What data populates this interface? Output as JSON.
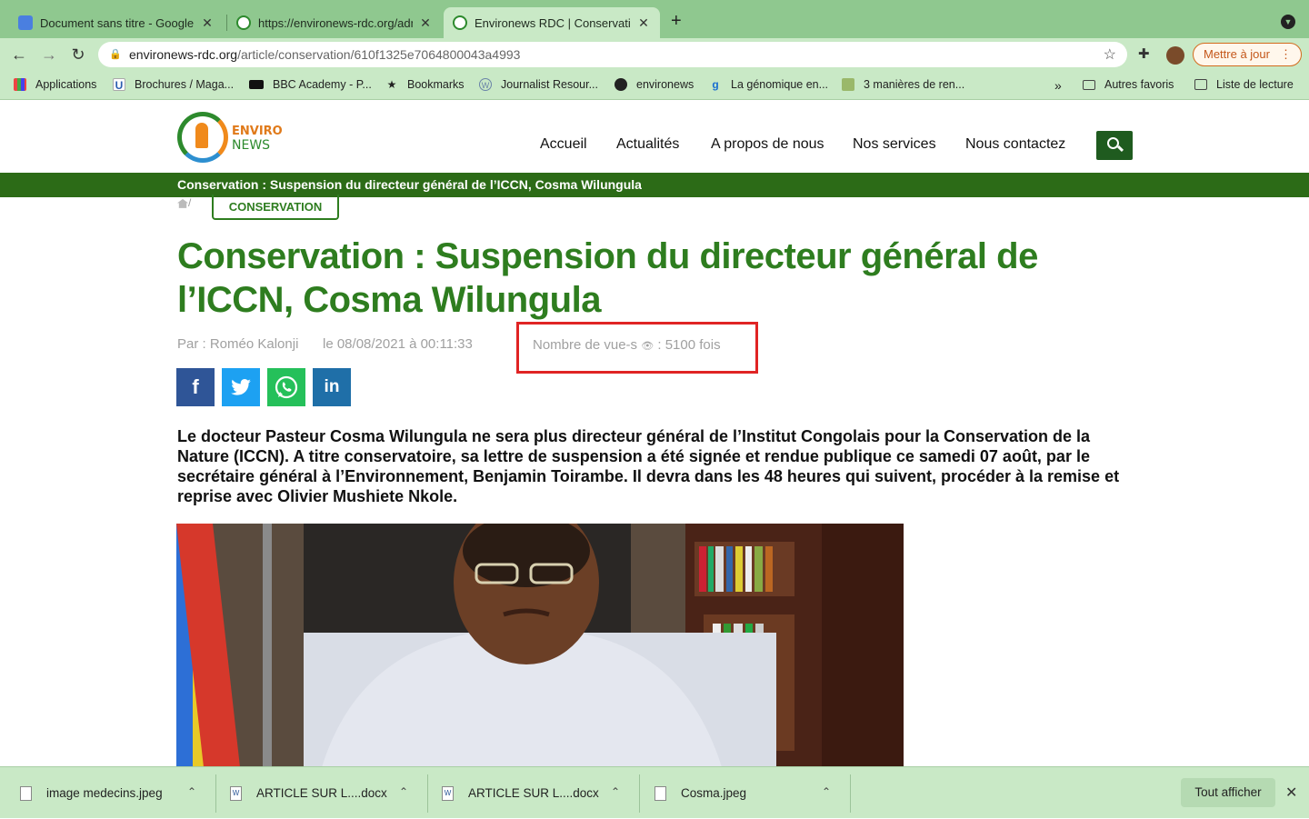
{
  "browser": {
    "tabs": [
      {
        "title": "Document sans titre - Google Docs",
        "active": false
      },
      {
        "title": "https://environews-rdc.org/admin",
        "active": false
      },
      {
        "title": "Environews RDC | Conservation",
        "active": true
      }
    ],
    "url_domain": "environews-rdc.org",
    "url_path": "/article/conservation/610f1325e7064800043a4993",
    "update_label": "Mettre à jour",
    "bookmarks": [
      "Applications",
      "Brochures / Maga...",
      "BBC Academy - P...",
      "Bookmarks",
      "Journalist Resour...",
      "environews",
      "La génomique en...",
      "3 manières de ren..."
    ],
    "bookmarks_right": [
      "Autres favoris",
      "Liste de lecture"
    ],
    "bookmark_overflow": "»"
  },
  "site": {
    "logo_line1": "ENVIRO",
    "logo_line2": "NEWS",
    "menu": [
      "Accueil",
      "Actualités",
      "A propos de nous",
      "Nos services",
      "Nous contactez"
    ],
    "ticker": "Conservation : Suspension du directeur général de l’ICCN, Cosma Wilungula"
  },
  "article": {
    "breadcrumb_sep": "/",
    "category": "CONSERVATION",
    "title": "Conservation : Suspension du directeur général de l’ICCN, Cosma Wilungula",
    "author": "Par : Roméo Kalonji",
    "date": "le 08/08/2021 à 00:11:33",
    "views_label": "Nombre de vue-s",
    "views_value": ": 5100 fois",
    "share": [
      {
        "name": "facebook",
        "glyph": "f",
        "color": "#2f5597"
      },
      {
        "name": "twitter",
        "glyph": "t",
        "color": "#1da1f2"
      },
      {
        "name": "whatsapp",
        "glyph": "w",
        "color": "#25c05a"
      },
      {
        "name": "linkedin",
        "glyph": "in",
        "color": "#1f6fa8"
      }
    ],
    "lead": "Le docteur Pasteur Cosma Wilungula ne sera plus directeur général de l’Institut Congolais pour la Conservation de la Nature (ICCN). A titre conservatoire, sa lettre de suspension a été signée et rendue publique ce samedi 07 août, par le secrétaire général à l’Environnement, Benjamin Toirambe. Il devra dans les 48 heures qui suivent, procéder à la remise et reprise avec Olivier Mushiete Nkole."
  },
  "downloads": {
    "items": [
      "image medecins.jpeg",
      "ARTICLE SUR L....docx",
      "ARTICLE SUR L....docx",
      "Cosma.jpeg"
    ],
    "show_all": "Tout afficher"
  }
}
